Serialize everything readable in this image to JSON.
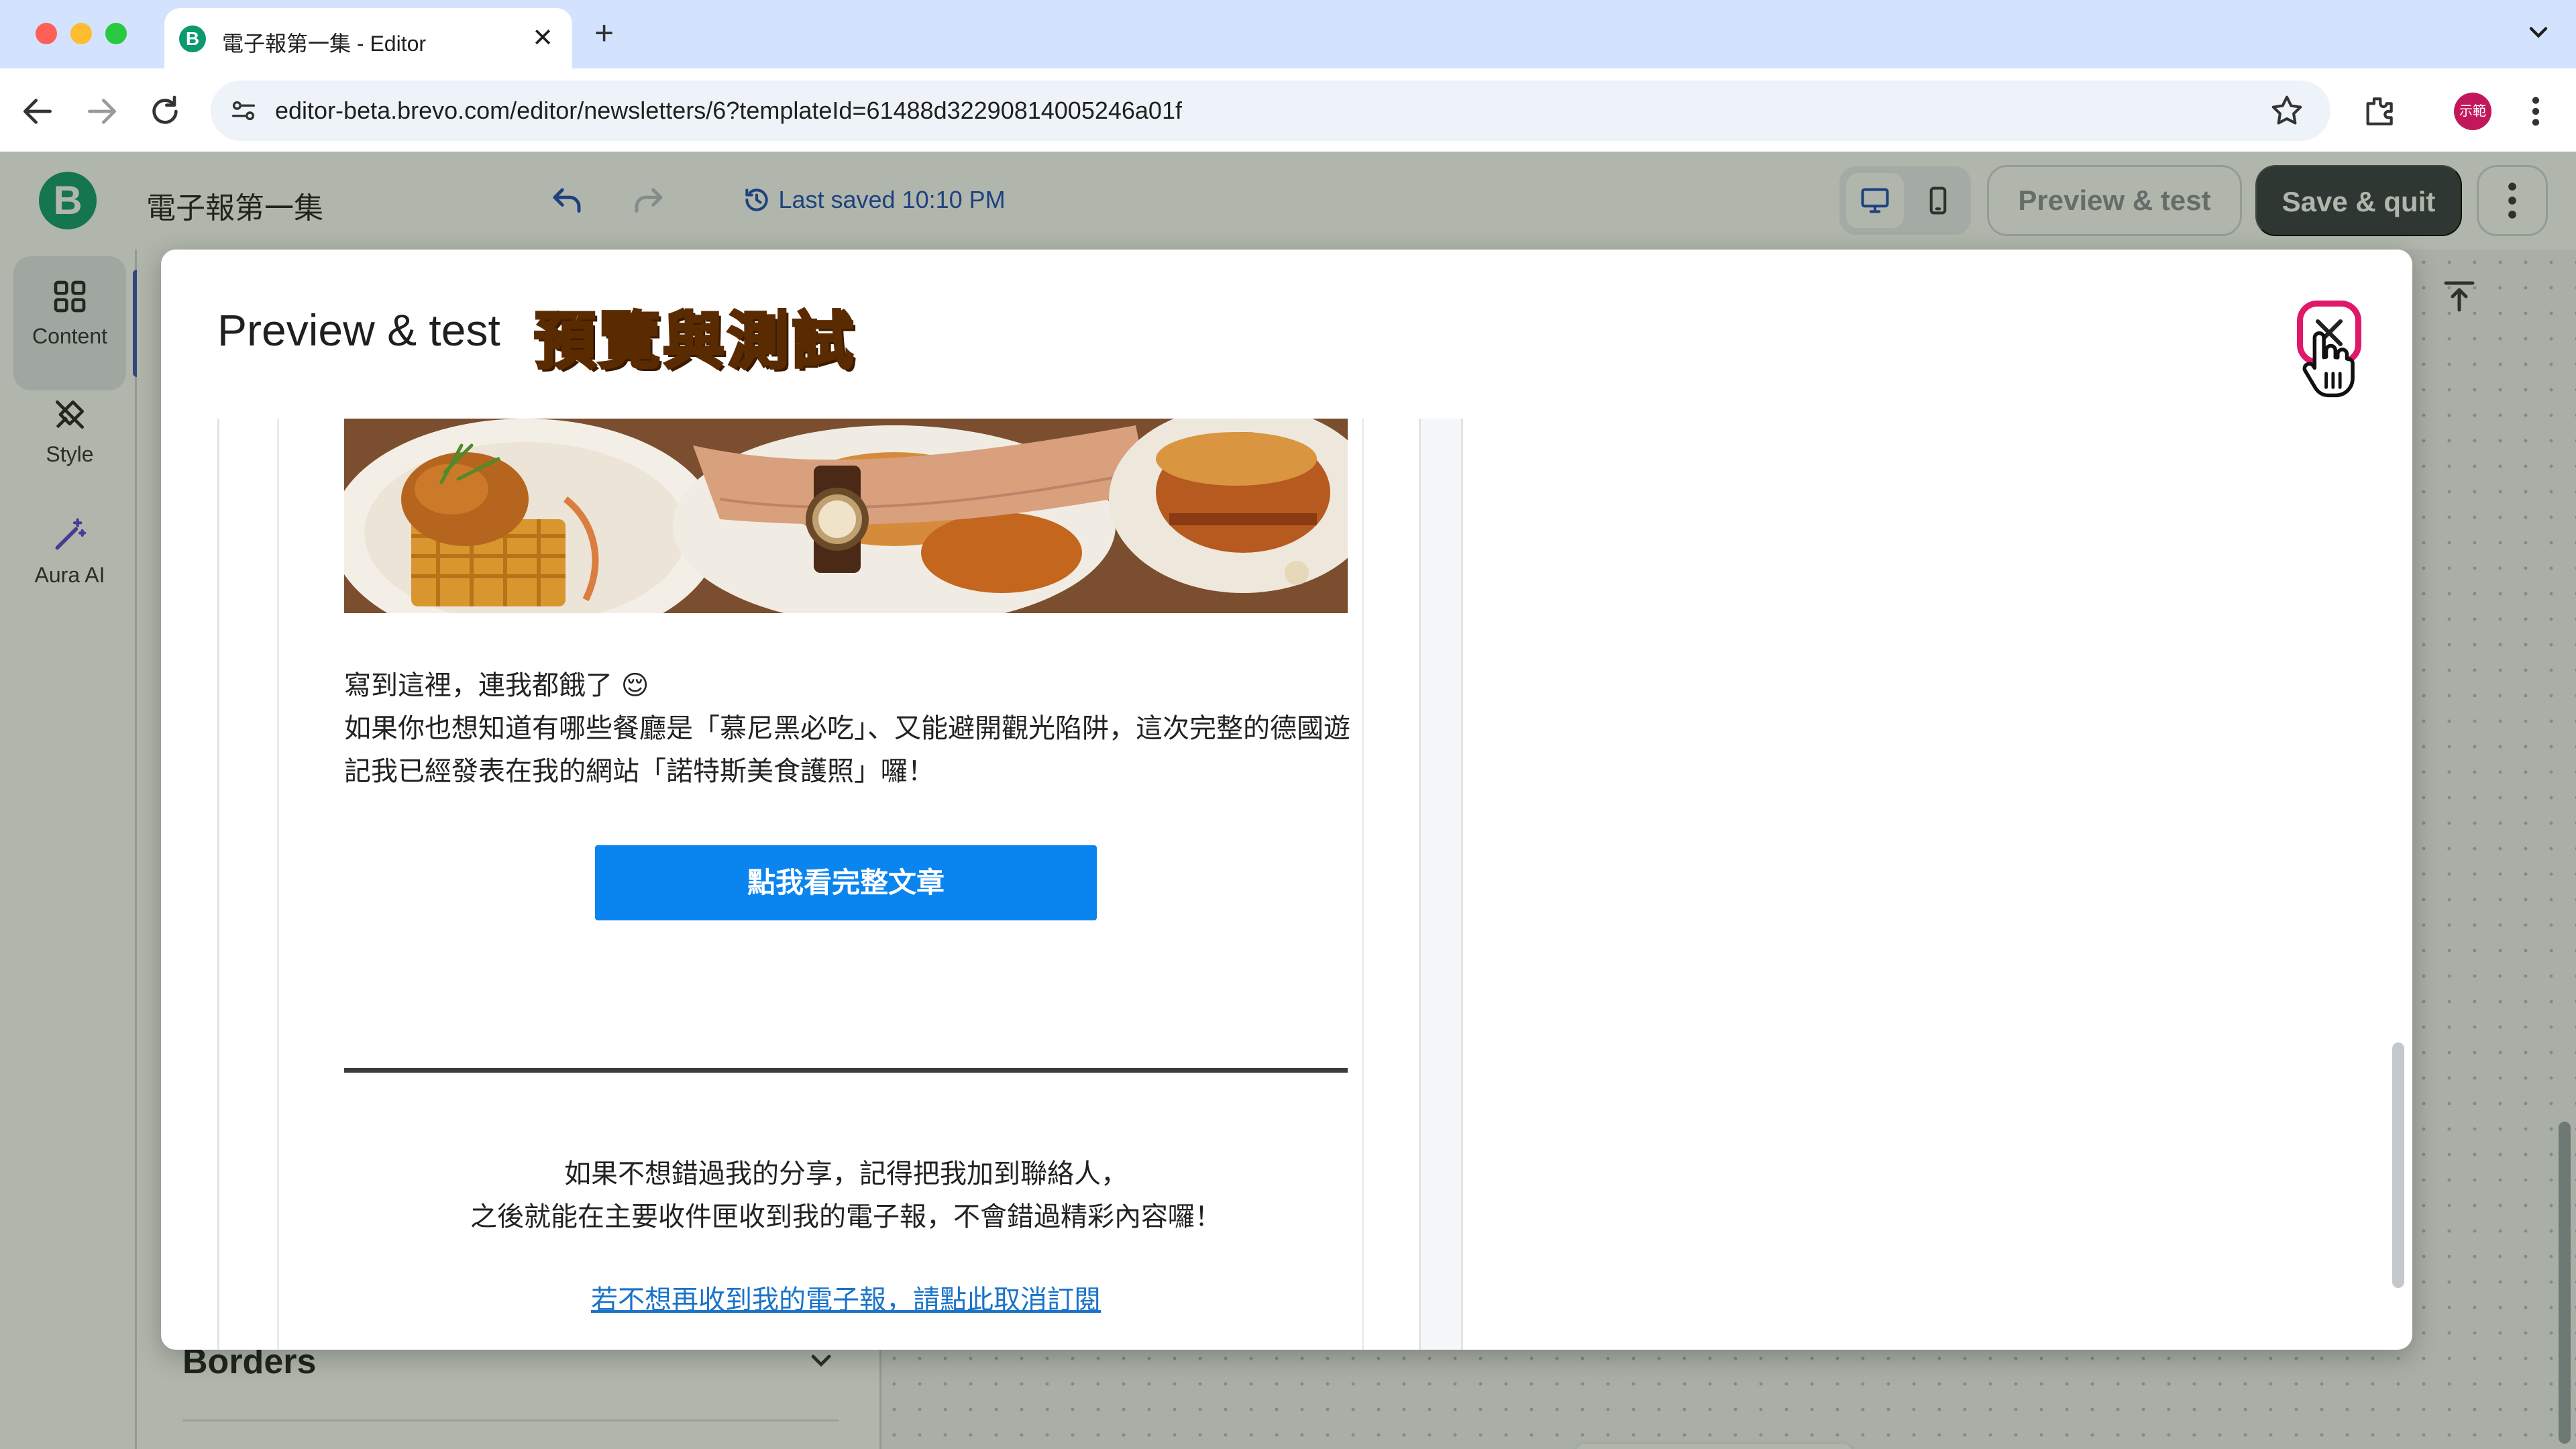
{
  "browser": {
    "tab_title": "電子報第一集 - Editor",
    "favicon_letter": "B",
    "url": "editor-beta.brevo.com/editor/newsletters/6?templateId=61488d32290814005246a01f",
    "profile_label": "示範"
  },
  "editor": {
    "brand_letter": "B",
    "doc_title": "電子報第一集",
    "last_saved": "Last saved 10:10 PM",
    "preview_label": "Preview & test",
    "save_quit_label": "Save & quit",
    "rail": [
      {
        "label": "Content",
        "icon": "grid-icon"
      },
      {
        "label": "Style",
        "icon": "brush-icon"
      },
      {
        "label": "Aura AI",
        "icon": "magic-wand-icon"
      }
    ],
    "panel": {
      "borders_label": "Borders"
    }
  },
  "modal": {
    "title": "Preview & test",
    "badge": "預覽與測試",
    "email": {
      "paragraph1": "寫到這裡，連我都餓了 😌",
      "paragraph2": "如果你也想知道有哪些餐廳是「慕尼黑必吃」、又能避開觀光陷阱，這次完整的德國遊記我已經發表在我的網站「諾特斯美食護照」囉！",
      "cta_label": "點我看完整文章",
      "footer_line1": "如果不想錯過我的分享，記得把我加到聯絡人，",
      "footer_line2": "之後就能在主要收件匣收到我的電子報，不會錯過精彩內容囉！",
      "unsubscribe_link": "若不想再收到我的電子報，請點此取消訂閱"
    }
  },
  "colors": {
    "cta": "#0a84ef",
    "close_highlight": "#e0186a",
    "badge": "#f39c12",
    "brand": "#0b996e"
  }
}
